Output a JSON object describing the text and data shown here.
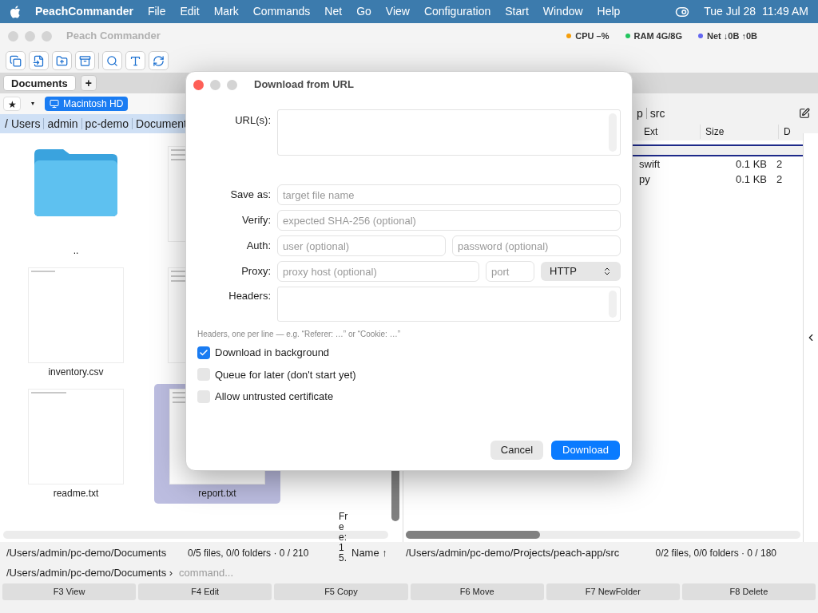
{
  "menu_bar": {
    "app": "PeachCommander",
    "items": [
      "File",
      "Edit",
      "Mark",
      "Commands",
      "Net",
      "Go",
      "View",
      "Configuration",
      "Start",
      "Window",
      "Help"
    ],
    "clock": "Tue Jul 28  11:49 AM"
  },
  "window": {
    "title": "Peach Commander",
    "stats": [
      {
        "label": "CPU –%",
        "color": "#f59e0b"
      },
      {
        "label": "RAM 4G/8G",
        "color": "#22c55e"
      },
      {
        "label": "Net ↓0B ↑0B",
        "color": "#6366f1"
      }
    ]
  },
  "toolbar": {
    "tools": [
      {
        "kind": "copy"
      },
      {
        "kind": "move"
      },
      {
        "kind": "newfolder"
      },
      {
        "kind": "archive"
      },
      {
        "kind": "search"
      },
      {
        "kind": "rename"
      },
      {
        "kind": "refresh"
      }
    ]
  },
  "tabs": [
    {
      "label": "Documents",
      "selected": true
    }
  ],
  "add_tab": "+",
  "left_panel": {
    "favorites": "★",
    "dropdown": "▾",
    "volume": "Macintosh HD",
    "path": [
      "/",
      "Users",
      "admin",
      "pc-demo",
      "Document"
    ],
    "items": [
      {
        "kind": "folder",
        "name": "..",
        "selected": false
      },
      {
        "kind": "doc"
      },
      {
        "kind": "sheet",
        "name": "inventory.csv",
        "selected": false
      },
      {
        "kind": "doc"
      },
      {
        "kind": "text",
        "name": "readme.txt",
        "selected": false
      },
      {
        "kind": "doc",
        "name": "report.txt",
        "selected": true
      }
    ],
    "free": "Free: 15.",
    "status_path": "/Users/admin/pc-demo/Documents",
    "status_counts": "0/5 files, 0/0 folders · 0 / 210",
    "sort": "Name ↑"
  },
  "right_panel": {
    "path": [
      "p",
      "src"
    ],
    "columns": [
      "Ext",
      "Size",
      "D"
    ],
    "rows": [
      {
        "ext": "swift",
        "size": "0.1 KB",
        "date": "2"
      },
      {
        "ext": "py",
        "size": "0.1 KB",
        "date": "2"
      }
    ],
    "status_path": "/Users/admin/pc-demo/Projects/peach-app/src",
    "status_counts": "0/2 files, 0/0 folders · 0 / 180"
  },
  "command_line": {
    "prompt": "/Users/admin/pc-demo/Documents ›",
    "placeholder": "command..."
  },
  "function_keys": [
    "F3 View",
    "F4 Edit",
    "F5 Copy",
    "F6 Move",
    "F7 NewFolder",
    "F8 Delete"
  ],
  "dialog": {
    "title": "Download from URL",
    "url_label": "URL(s):",
    "save_label": "Save as:",
    "save_placeholder": "target file name",
    "verify_label": "Verify:",
    "verify_placeholder": "expected SHA-256 (optional)",
    "auth_label": "Auth:",
    "user_placeholder": "user (optional)",
    "password_placeholder": "password (optional)",
    "proxy_label": "Proxy:",
    "proxy_placeholder": "proxy host (optional)",
    "port_placeholder": "port",
    "proxy_type": "HTTP",
    "headers_label": "Headers:",
    "headers_hint": "Headers, one per line — e.g. “Referer: …” or “Cookie: …”",
    "options": [
      {
        "label": "Download in background",
        "checked": true
      },
      {
        "label": "Queue for later (don't start yet)",
        "checked": false
      },
      {
        "label": "Allow untrusted certificate",
        "checked": false
      }
    ],
    "buttons": [
      {
        "label": "Cancel",
        "kind": "secondary"
      },
      {
        "label": "Download",
        "kind": "primary"
      }
    ]
  }
}
